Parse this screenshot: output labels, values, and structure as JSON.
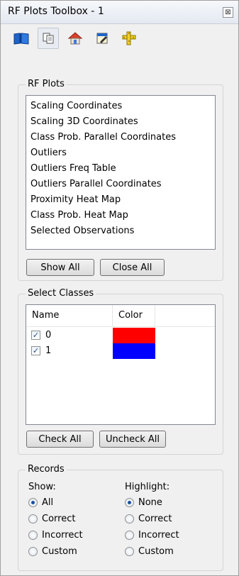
{
  "window": {
    "title": "RF Plots Toolbox - 1",
    "close_glyph": "⊠"
  },
  "toolbar": {
    "icons": [
      "book-icon",
      "copy-icon",
      "home-icon",
      "edit-icon",
      "ruler-icon"
    ]
  },
  "rf_plots": {
    "label": "RF Plots",
    "items": [
      "Scaling Coordinates",
      "Scaling 3D Coordinates",
      "Class Prob. Parallel Coordinates",
      "Outliers",
      "Outliers Freq Table",
      "Outliers Parallel Coordinates",
      "Proximity Heat Map",
      "Class Prob. Heat Map",
      "Selected Observations"
    ],
    "show_all": "Show All",
    "close_all": "Close All"
  },
  "select_classes": {
    "label": "Select Classes",
    "col_name": "Name",
    "col_color": "Color",
    "rows": [
      {
        "name": "0",
        "checked": true,
        "color": "#ff0000"
      },
      {
        "name": "1",
        "checked": true,
        "color": "#0000ff"
      }
    ],
    "check_all": "Check All",
    "uncheck_all": "Uncheck All"
  },
  "records": {
    "label": "Records",
    "show": {
      "label": "Show:",
      "options": [
        "All",
        "Correct",
        "Incorrect",
        "Custom"
      ],
      "selected": "All"
    },
    "highlight": {
      "label": "Highlight:",
      "options": [
        "None",
        "Correct",
        "Incorrect",
        "Custom"
      ],
      "selected": "None"
    }
  },
  "colors": {
    "accent": "#1b4ea0",
    "class0": "#ff0000",
    "class1": "#0000ff"
  }
}
